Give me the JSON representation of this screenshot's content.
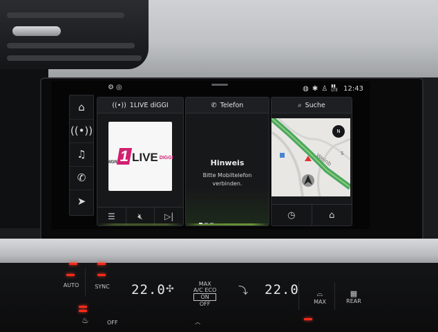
{
  "status": {
    "time": "12:43",
    "left_icons": [
      "car-icon",
      "settings-icon"
    ],
    "right_icons": [
      "signal-icon",
      "bluetooth-icon",
      "person-icon",
      "lte-icon"
    ],
    "lte_label": "LTE"
  },
  "sidenav": [
    {
      "name": "home",
      "icon": "home-icon"
    },
    {
      "name": "radio",
      "icon": "radio-icon"
    },
    {
      "name": "media",
      "icon": "music-icon"
    },
    {
      "name": "phone",
      "icon": "phone-icon"
    },
    {
      "name": "navigation",
      "icon": "navigation-icon"
    }
  ],
  "radio": {
    "title": "1LIVE diGGI",
    "logo_one": "1",
    "logo_live": "LIVE",
    "logo_diggi": "DIGGI",
    "logo_wdr": "WDR",
    "controls": [
      "list-icon",
      "mute-icon",
      "skip-next-icon"
    ]
  },
  "phone": {
    "title": "Telefon",
    "heading": "Hinweis",
    "message_line1": "Bitte Mobiltelefon",
    "message_line2": "verbinden."
  },
  "navigation": {
    "title": "Suche",
    "compass_label": "N",
    "controls": [
      "history-icon",
      "home-icon"
    ],
    "accent_color": "#2f9a4a"
  },
  "climate": {
    "auto_label": "AUTO",
    "sync_label": "SYNC",
    "left_temp": "22.0",
    "right_temp": "22.0",
    "ac_label": "A/C",
    "max_label": "MAX",
    "eco_label": "ECO",
    "on_label": "ON",
    "off_label": "OFF",
    "seat_off_label": "OFF",
    "max_defrost_label": "MAX",
    "rear_label": "REAR",
    "led_color": "#ff2a1a"
  }
}
